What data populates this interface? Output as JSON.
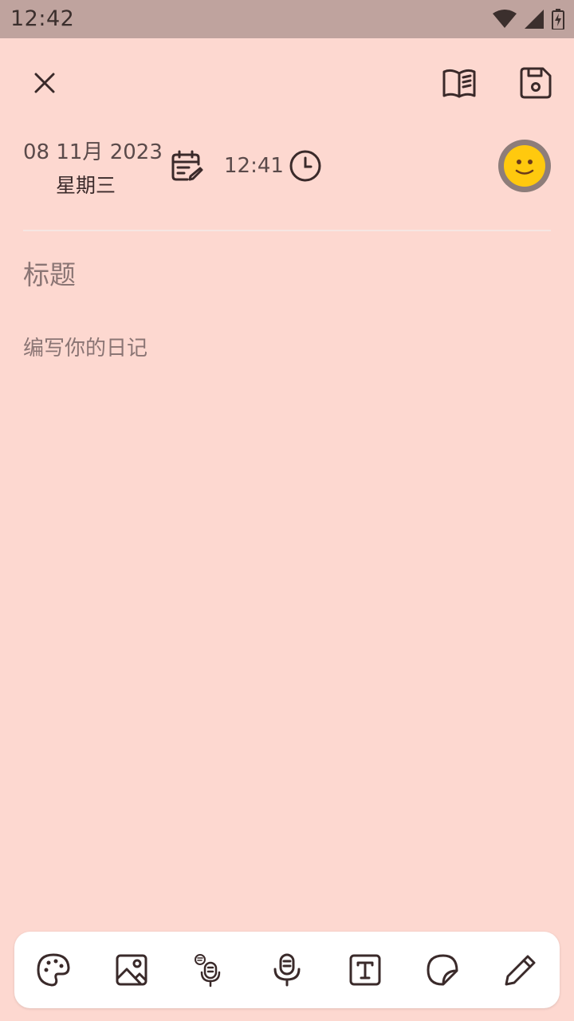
{
  "status_bar": {
    "time": "12:42"
  },
  "header": {
    "close_icon": "close-icon",
    "book_icon": "book-icon",
    "save_icon": "save-icon"
  },
  "entry": {
    "date": "08 11月 2023",
    "weekday": "星期三",
    "time": "12:41",
    "mood_icon": "smiley-icon",
    "title_placeholder": "标题",
    "body_placeholder": "编写你的日记"
  },
  "toolbar": {
    "items": [
      "palette-icon",
      "image-icon",
      "speech-to-text-icon",
      "microphone-icon",
      "text-icon",
      "sticker-icon",
      "pencil-icon"
    ]
  },
  "colors": {
    "background": "#FDD8D0",
    "status_bar": "#BFA39E",
    "icon": "#3a2a2a",
    "mood_face": "#FFC90E"
  }
}
